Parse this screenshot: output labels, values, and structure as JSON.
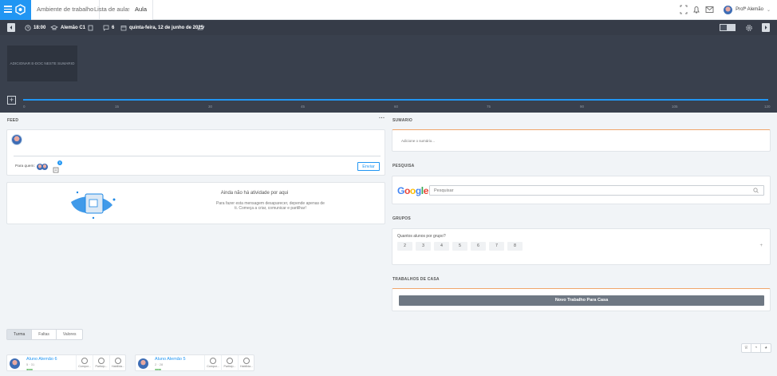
{
  "nav": {
    "tabs": [
      {
        "label": "Ambiente de trabalho"
      },
      {
        "label": "Lista de aulas"
      },
      {
        "label": "Aula"
      }
    ],
    "user_name": "Profª Alemão"
  },
  "toolbar": {
    "time": "18:00",
    "class_name": "Alemão C1",
    "count": "6",
    "date": "quinta-feira, 12 de junho de 2025"
  },
  "timeline": {
    "add_doc_label": "ADICIONAR E-DOC NESTE SUMARIO",
    "plus_label": "+",
    "ticks": [
      "0",
      "15",
      "30",
      "45",
      "60",
      "75",
      "90",
      "105",
      "120"
    ]
  },
  "feed": {
    "title": "FEED",
    "more": "···",
    "para_quem": "Para quem:",
    "badge": "0",
    "send_label": "Enviar",
    "empty_title": "Ainda não há atividade por aqui",
    "empty_text": "Para fazer esta mensagem desaparecer, depende apenas de ti. Começa a criar, comunicar e partilhar!"
  },
  "bottom_tabs": [
    {
      "label": "Turma"
    },
    {
      "label": "Faltas"
    },
    {
      "label": "Valores"
    }
  ],
  "students": [
    {
      "name": "Aluno Alemão 6",
      "number": "5 · 31",
      "dots": "●●●●",
      "actions": [
        "Compor...",
        "Particip...",
        "Habilida..."
      ]
    },
    {
      "name": "Aluno Alemão 5",
      "number": "2 · 28",
      "dots": "●●●●",
      "actions": [
        "Compor...",
        "Particip...",
        "Habilida..."
      ]
    }
  ],
  "sumario": {
    "title": "SUMARIO",
    "placeholder": "Adicione o sumário..."
  },
  "pesquisa": {
    "title": "PESQUISA",
    "google": "Google",
    "placeholder": "Pesquisar"
  },
  "grupos": {
    "title": "GRUPOS",
    "question": "Quantos alunos por grupo?",
    "options": [
      "2",
      "3",
      "4",
      "5",
      "6",
      "7",
      "8"
    ],
    "more": "+"
  },
  "trabalhos": {
    "title": "TRABALHOS DE CASA",
    "button": "Novo Trabalho Para Casa"
  },
  "colors": {
    "brand": "#2196f3",
    "toolbar_bg": "#363c48",
    "timeline_bg": "#39404d",
    "accent_orange": "#f0a56a"
  }
}
